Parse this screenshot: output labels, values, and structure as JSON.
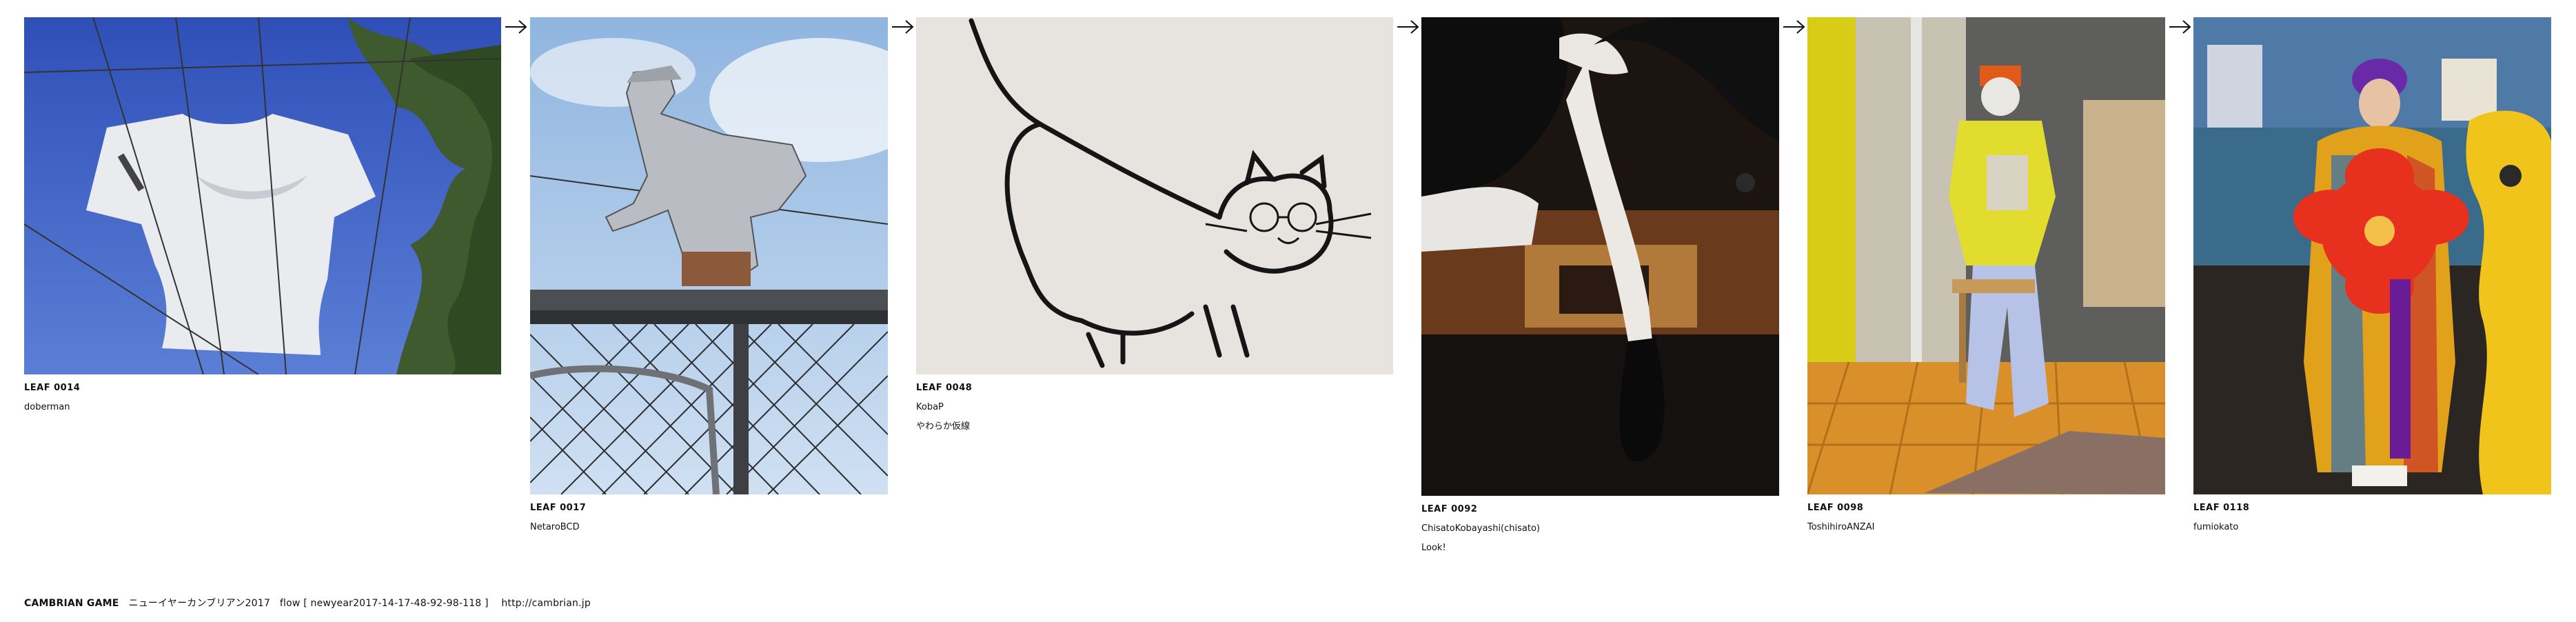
{
  "leaves": [
    {
      "id": "LEAF 0014",
      "author": "doberman",
      "note": ""
    },
    {
      "id": "LEAF 0017",
      "author": "NetaroBCD",
      "note": ""
    },
    {
      "id": "LEAF 0048",
      "author": "KobaP",
      "note": "やわらか仮線"
    },
    {
      "id": "LEAF 0092",
      "author": "ChisatoKobayashi(chisato)",
      "note": "Look!"
    },
    {
      "id": "LEAF 0098",
      "author": "ToshihiroANZAI",
      "note": ""
    },
    {
      "id": "LEAF 0118",
      "author": "fumiokato",
      "note": ""
    }
  ],
  "photos": [
    {
      "subject": "white t-shirt hanging on cables against blue sky and trees"
    },
    {
      "subject": "metal cutout sign of a crouching man on a chain-link fence"
    },
    {
      "subject": "ink drawing of a cat with glasses on a wall"
    },
    {
      "subject": "mannequin leg with black boot in a shop window"
    },
    {
      "subject": "mannequin in yellow shirt seated in a shop entrance"
    },
    {
      "subject": "woman in colorful kimono holding red flower bouquet beside shisa statue"
    }
  ],
  "arrow_icon": "right-arrow-icon",
  "footer": {
    "title": "CAMBRIAN GAME",
    "subtitle": "ニューイヤーカンブリアン2017",
    "flow": "flow [ newyear2017-14-17-48-92-98-118 ]",
    "url": "http://cambrian.jp"
  },
  "colors": {
    "background": "#ffffff",
    "text": "#111111"
  }
}
